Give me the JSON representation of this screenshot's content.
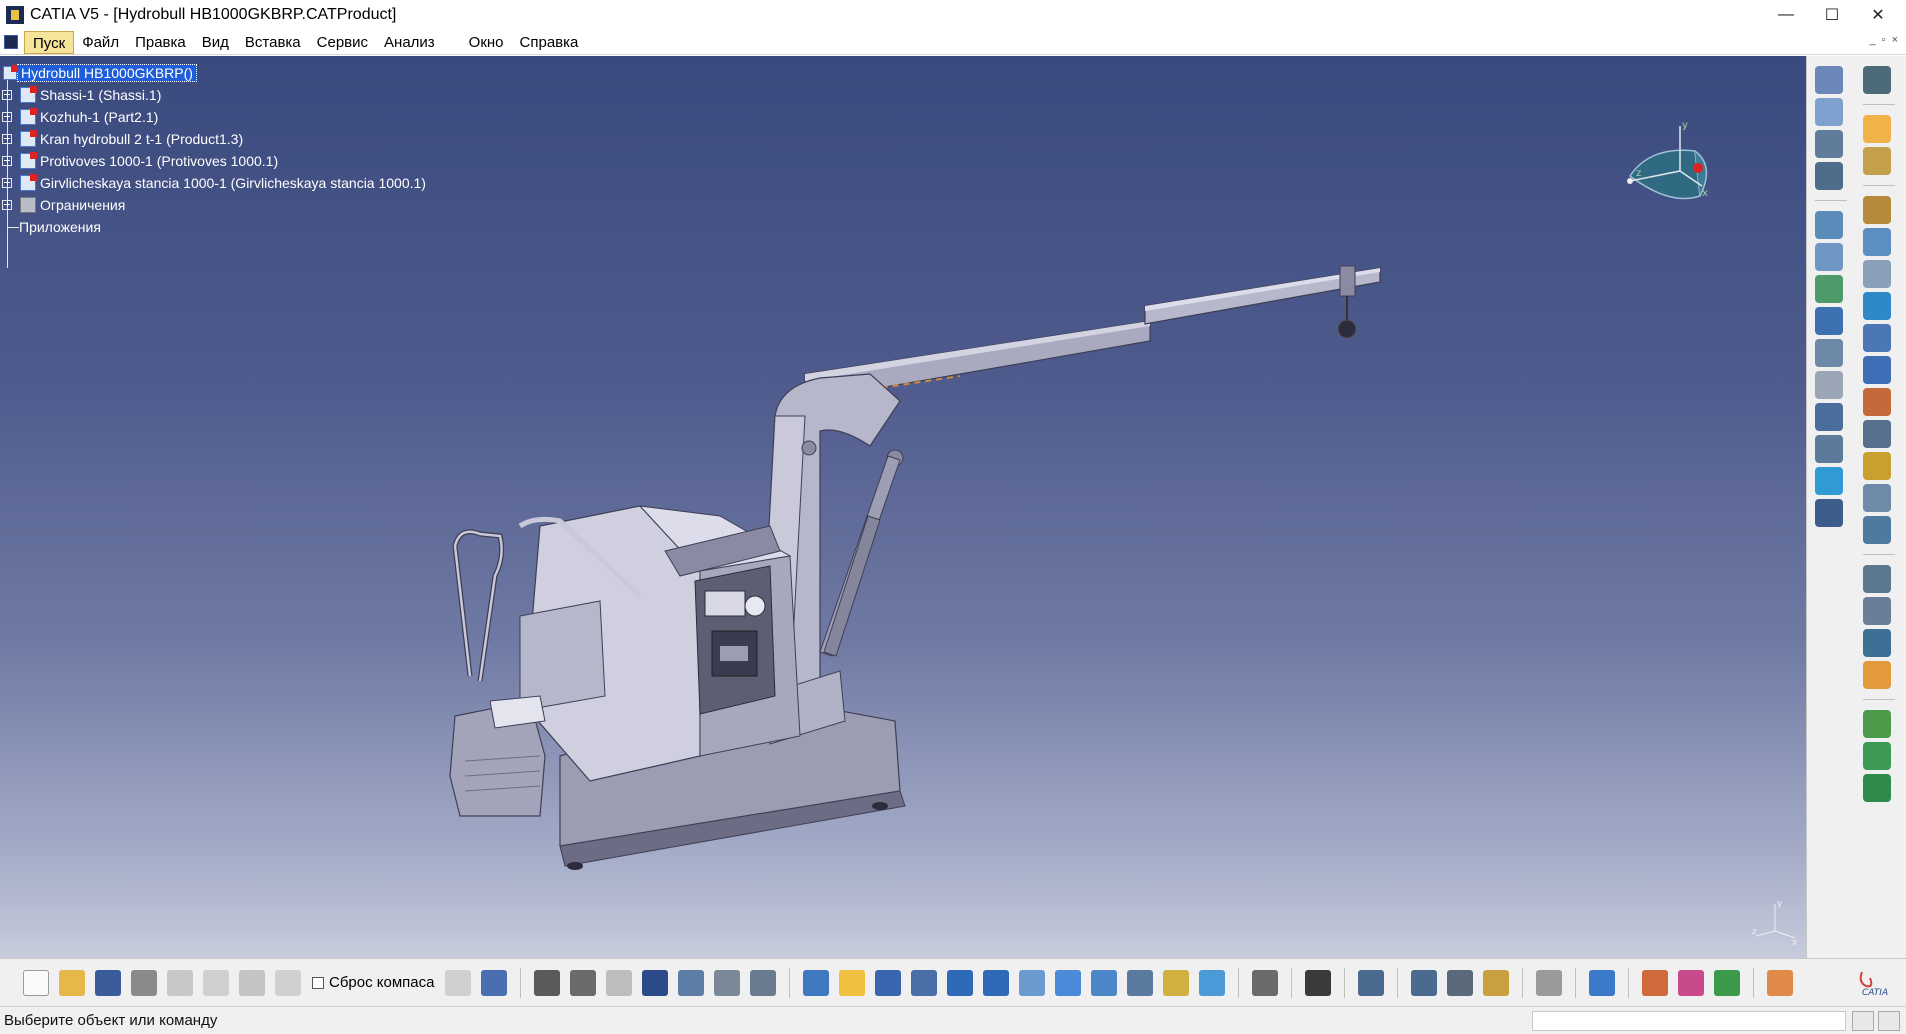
{
  "window": {
    "title": "CATIA V5 - [Hydrobull HB1000GKBRP.CATProduct]",
    "controls": {
      "minimize": "—",
      "maximize": "☐",
      "close": "✕"
    }
  },
  "menu": {
    "items": [
      "Пуск",
      "Файл",
      "Правка",
      "Вид",
      "Вставка",
      "Сервис",
      "Анализ",
      "Окно",
      "Справка"
    ],
    "active": "Пуск",
    "mdi_controls": [
      "_",
      "▫",
      "×"
    ]
  },
  "tree": {
    "root": "Hydrobull HB1000GKBRP()",
    "children": [
      {
        "label": "Shassi-1 (Shassi.1)",
        "icon": "product-icon"
      },
      {
        "label": "Kozhuh-1 (Part2.1)",
        "icon": "part-icon"
      },
      {
        "label": "Kran hydrobull 2 t-1 (Product1.3)",
        "icon": "product-icon"
      },
      {
        "label": "Protivoves 1000-1 (Protivoves 1000.1)",
        "icon": "product-icon"
      },
      {
        "label": "Girvlicheskaya stancia 1000-1 (Girvlicheskaya stancia 1000.1)",
        "icon": "product-icon"
      },
      {
        "label": "Ограничения",
        "icon": "constraints-icon"
      }
    ],
    "applications": "Приложения"
  },
  "compass": {
    "labels": {
      "x": "x",
      "y": "y",
      "z": "z"
    }
  },
  "axis_triad": {
    "labels": {
      "x": "x",
      "y": "y",
      "z": "z"
    }
  },
  "bottom_toolbar": {
    "compass_reset_label": "Сброс компаса",
    "compass_reset_checked": false,
    "logo_text": "CATIA"
  },
  "status": {
    "text": "Выберите объект или команду",
    "command_input": ""
  },
  "colors": {
    "selection": "#1f5ed8",
    "menu_active": "#f7e49b",
    "viewport_top": "#3a4a7e",
    "viewport_bottom": "#c7ccdc",
    "model_light": "#c9c9da",
    "model_mid": "#a7a7bd",
    "model_dark": "#6c6c84"
  }
}
